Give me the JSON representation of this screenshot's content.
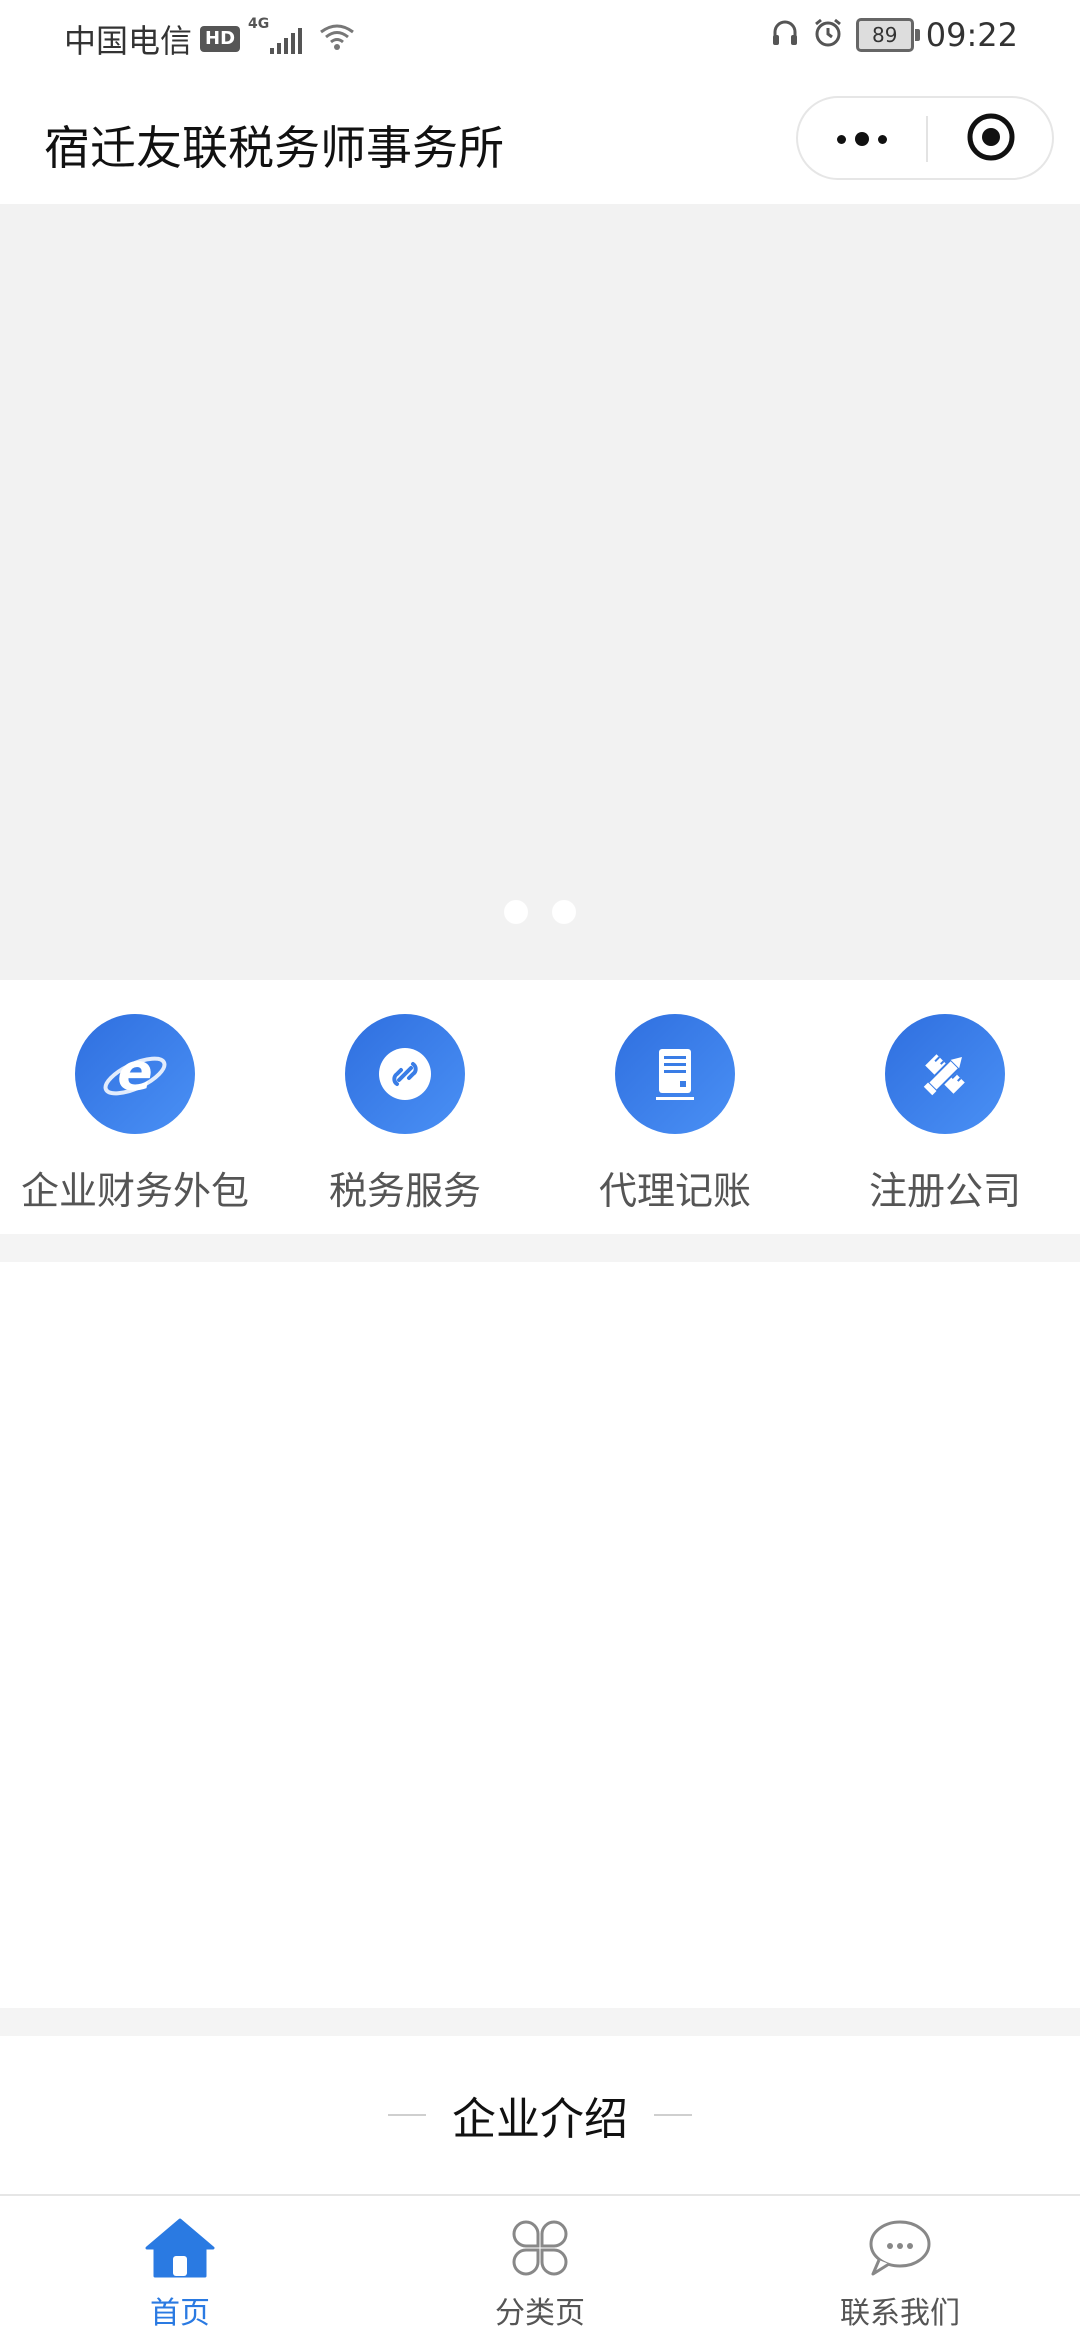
{
  "status_bar": {
    "carrier": "中国电信",
    "hd_badge": "HD",
    "network": "4G",
    "battery": "89",
    "time": "09:22"
  },
  "title_bar": {
    "title": "宿迁友联税务师事务所",
    "more_icon": "more-dots-icon",
    "close_icon": "target-circle-icon"
  },
  "banner": {
    "dot_count": 2
  },
  "categories": [
    {
      "label": "企业财务外包",
      "icon": "browser-e-icon"
    },
    {
      "label": "税务服务",
      "icon": "link-icon"
    },
    {
      "label": "代理记账",
      "icon": "document-icon"
    },
    {
      "label": "注册公司",
      "icon": "pencil-ruler-icon"
    }
  ],
  "section": {
    "title": "企业介绍"
  },
  "tab_bar": {
    "tabs": [
      {
        "label": "首页",
        "icon": "home-icon",
        "active": true
      },
      {
        "label": "分类页",
        "icon": "category-icon",
        "active": false
      },
      {
        "label": "联系我们",
        "icon": "chat-icon",
        "active": false
      }
    ]
  },
  "colors": {
    "accent": "#2a7ae2",
    "icon_gradient_start": "#2f6fdf",
    "icon_gradient_end": "#4a90f5",
    "banner_bg": "#f2f2f2"
  }
}
